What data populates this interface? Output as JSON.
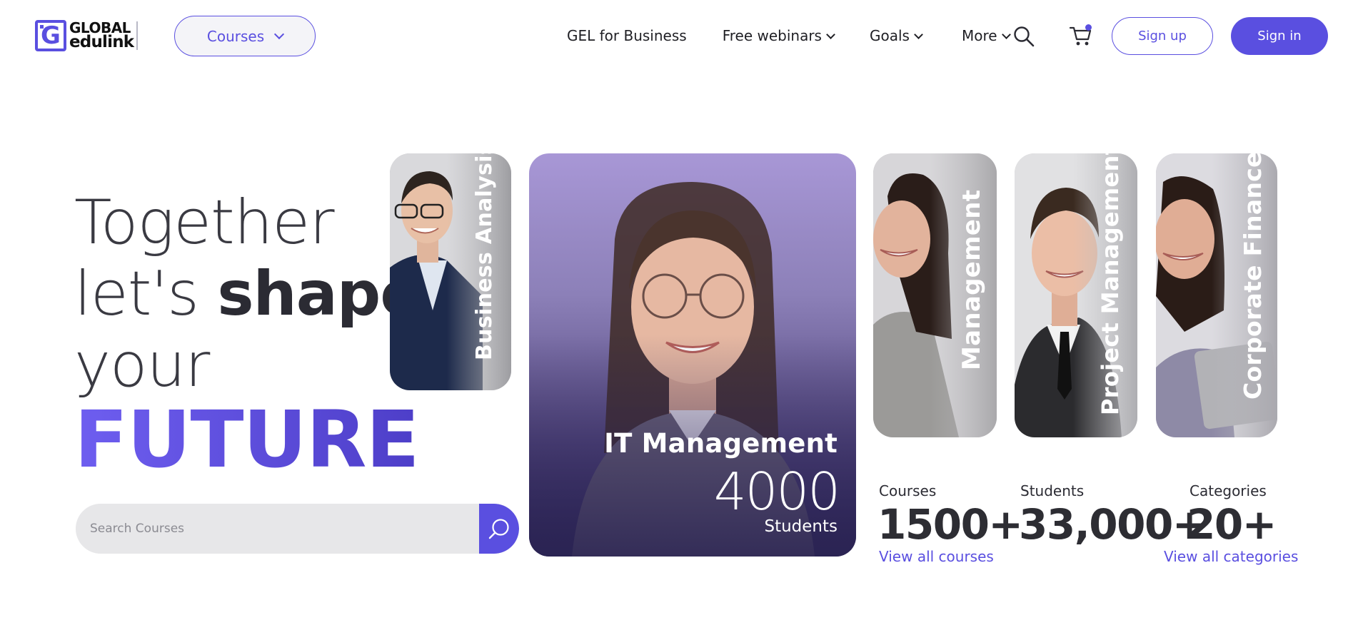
{
  "nav": {
    "logo_line1": "GLOBAL",
    "logo_line2": "edulink",
    "logo_mark": "G",
    "courses_dropdown": "Courses",
    "links": {
      "gel": "GEL for Business",
      "webinars": "Free webinars",
      "goals": "Goals",
      "more": "More"
    },
    "signup": "Sign up",
    "signin": "Sign in"
  },
  "hero": {
    "line1": "Together",
    "line2_light": "let's",
    "line2_bold": "shape",
    "line3": "your",
    "line4": "FUTURE",
    "search_placeholder": "Search Courses"
  },
  "cards": {
    "business_analysis": "Business Analysis",
    "it_management": {
      "title": "IT Management",
      "count": "4000",
      "subtitle": "Students"
    },
    "management": "Management",
    "project_management": "Project Management",
    "corporate_finance": "Corporate Finance"
  },
  "stats": {
    "courses": {
      "label": "Courses",
      "value": "1500+",
      "link": "View all courses"
    },
    "students": {
      "label": "Students",
      "value": "33,000+"
    },
    "categories": {
      "label": "Categories",
      "value": "20+",
      "link": "View all categories"
    }
  },
  "colors": {
    "accent": "#5a4fe0",
    "text_dark": "#2b2b33",
    "search_bg": "#e7e7e9"
  },
  "icons": {
    "search": "search-icon",
    "cart": "cart-icon",
    "chevron": "chevron-down-icon"
  }
}
